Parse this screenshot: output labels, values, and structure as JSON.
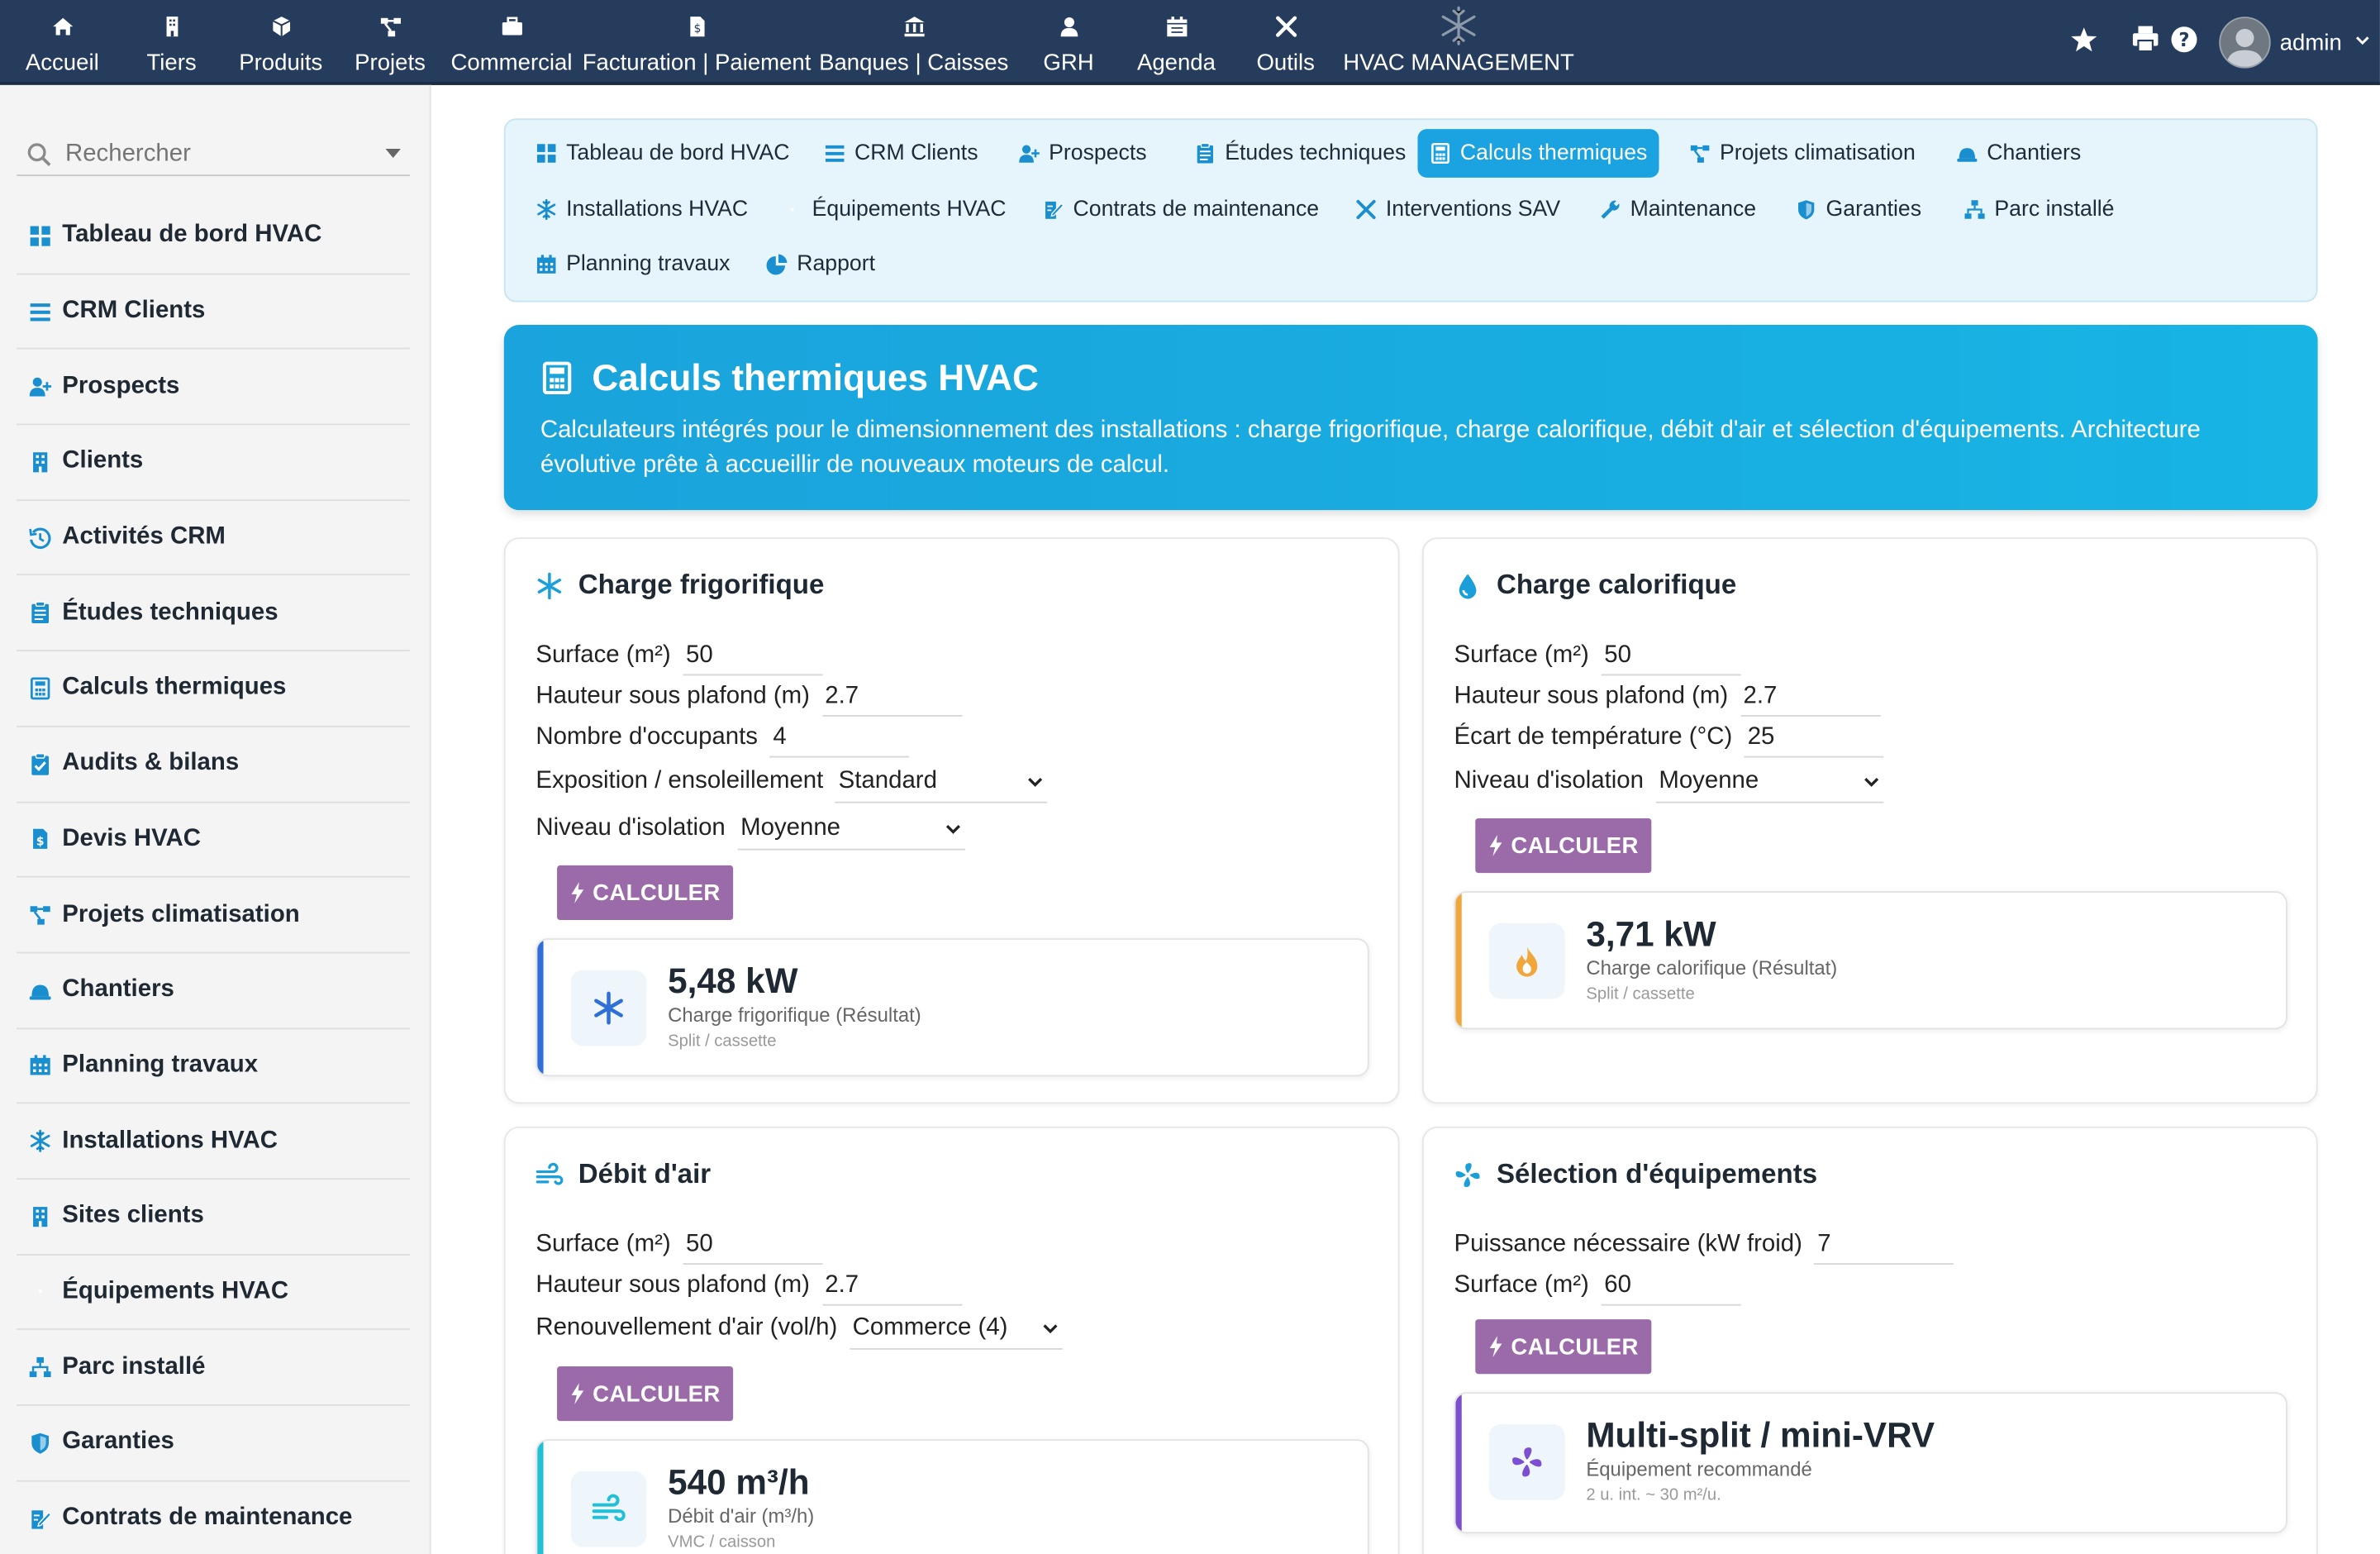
{
  "topnav": {
    "items": [
      {
        "label": "Accueil",
        "icon": "home-icon"
      },
      {
        "label": "Tiers",
        "icon": "building-icon"
      },
      {
        "label": "Produits",
        "icon": "cube-icon"
      },
      {
        "label": "Projets",
        "icon": "project-icon"
      },
      {
        "label": "Commercial",
        "icon": "briefcase-icon"
      },
      {
        "label": "Facturation | Paiement",
        "icon": "invoice-icon"
      },
      {
        "label": "Banques | Caisses",
        "icon": "bank-icon"
      },
      {
        "label": "GRH",
        "icon": "user-icon"
      },
      {
        "label": "Agenda",
        "icon": "calendar-icon"
      },
      {
        "label": "Outils",
        "icon": "tools-icon"
      },
      {
        "label": "HVAC MANAGEMENT",
        "icon": "snowflake-logo-icon"
      }
    ],
    "user": "admin"
  },
  "sidebar": {
    "search_placeholder": "Rechercher",
    "items": [
      {
        "label": "Tableau de bord HVAC",
        "icon": "dashboard-icon"
      },
      {
        "label": "CRM Clients",
        "icon": "list-icon"
      },
      {
        "label": "Prospects",
        "icon": "user-plus-icon"
      },
      {
        "label": "Clients",
        "icon": "building-icon"
      },
      {
        "label": "Activités CRM",
        "icon": "history-icon"
      },
      {
        "label": "Études techniques",
        "icon": "clipboard-icon"
      },
      {
        "label": "Calculs thermiques",
        "icon": "calculator-icon"
      },
      {
        "label": "Audits & bilans",
        "icon": "clipboard-check-icon"
      },
      {
        "label": "Devis HVAC",
        "icon": "invoice-icon"
      },
      {
        "label": "Projets climatisation",
        "icon": "project-icon"
      },
      {
        "label": "Chantiers",
        "icon": "hardhat-icon"
      },
      {
        "label": "Planning travaux",
        "icon": "calendar-icon"
      },
      {
        "label": "Installations HVAC",
        "icon": "snowflake-icon"
      },
      {
        "label": "Sites clients",
        "icon": "building-icon"
      },
      {
        "label": "Équipements HVAC",
        "icon": "fan-icon"
      },
      {
        "label": "Parc installé",
        "icon": "network-icon"
      },
      {
        "label": "Garanties",
        "icon": "shield-icon"
      },
      {
        "label": "Contrats de maintenance",
        "icon": "contract-icon"
      }
    ]
  },
  "tabs": [
    {
      "label": "Tableau de bord HVAC",
      "icon": "dashboard-icon"
    },
    {
      "label": "CRM Clients",
      "icon": "list-icon"
    },
    {
      "label": "Prospects",
      "icon": "user-plus-icon"
    },
    {
      "label": "Études techniques",
      "icon": "clipboard-icon"
    },
    {
      "label": "Calculs thermiques",
      "icon": "calculator-icon",
      "active": true
    },
    {
      "label": "Projets climatisation",
      "icon": "project-icon"
    },
    {
      "label": "Chantiers",
      "icon": "hardhat-icon"
    },
    {
      "label": "Installations HVAC",
      "icon": "snowflake-icon"
    },
    {
      "label": "Équipements HVAC",
      "icon": "fan-icon"
    },
    {
      "label": "Contrats de maintenance",
      "icon": "contract-icon"
    },
    {
      "label": "Interventions SAV",
      "icon": "tools-icon"
    },
    {
      "label": "Maintenance",
      "icon": "wrench-icon"
    },
    {
      "label": "Garanties",
      "icon": "shield-icon"
    },
    {
      "label": "Parc installé",
      "icon": "network-icon"
    },
    {
      "label": "Planning travaux",
      "icon": "calendar-icon"
    },
    {
      "label": "Rapport",
      "icon": "pie-chart-icon"
    }
  ],
  "hero": {
    "title": "Calculs thermiques HVAC",
    "description": "Calculateurs intégrés pour le dimensionnement des installations : charge frigorifique, charge calorifique, débit d'air et sélection d'équipements. Architecture évolutive prête à accueillir de nouveaux moteurs de calcul."
  },
  "button_label": "CALCULER",
  "cards": {
    "frigo": {
      "title": "Charge frigorifique",
      "fields": [
        {
          "label": "Surface (m²)",
          "value": "50"
        },
        {
          "label": "Hauteur sous plafond (m)",
          "value": "2.7"
        },
        {
          "label": "Nombre d'occupants",
          "value": "4"
        },
        {
          "label": "Exposition / ensoleillement",
          "value": "Standard"
        },
        {
          "label": "Niveau d'isolation",
          "value": "Moyenne"
        }
      ],
      "result": {
        "value": "5,48 kW",
        "label": "Charge frigorifique (Résultat)",
        "sub": "Split / cassette"
      }
    },
    "calo": {
      "title": "Charge calorifique",
      "fields": [
        {
          "label": "Surface (m²)",
          "value": "50"
        },
        {
          "label": "Hauteur sous plafond (m)",
          "value": "2.7"
        },
        {
          "label": "Écart de température (°C)",
          "value": "25"
        },
        {
          "label": "Niveau d'isolation",
          "value": "Moyenne"
        }
      ],
      "result": {
        "value": "3,71 kW",
        "label": "Charge calorifique (Résultat)",
        "sub": "Split / cassette"
      }
    },
    "debit": {
      "title": "Débit d'air",
      "fields": [
        {
          "label": "Surface (m²)",
          "value": "50"
        },
        {
          "label": "Hauteur sous plafond (m)",
          "value": "2.7"
        },
        {
          "label": "Renouvellement d'air (vol/h)",
          "value": "Commerce (4)"
        }
      ],
      "result": {
        "value": "540 m³/h",
        "label": "Débit d'air (m³/h)",
        "sub": "VMC / caisson"
      }
    },
    "equip": {
      "title": "Sélection d'équipements",
      "fields": [
        {
          "label": "Puissance nécessaire (kW froid)",
          "value": "7"
        },
        {
          "label": "Surface (m²)",
          "value": "60"
        }
      ],
      "result": {
        "value": "Multi-split / mini-VRV",
        "label": "Équipement recommandé",
        "sub": "2 u. int. ~ 30 m²/u."
      }
    }
  },
  "colors": {
    "topbar": "#263c5c",
    "accent": "#1aa3e0",
    "button": "#9a6ba8",
    "frigo_bar": "#2f6fd6",
    "calo_bar": "#f0a63b",
    "debit_bar": "#22c0d6",
    "equip_bar": "#7b4fd0"
  }
}
